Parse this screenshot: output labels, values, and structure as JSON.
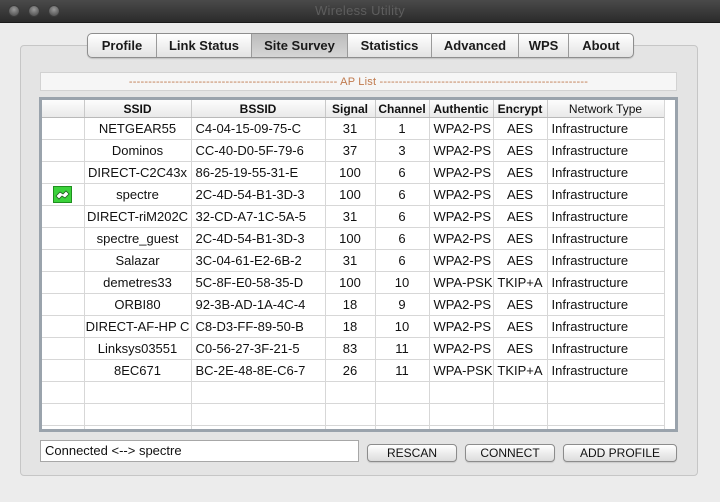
{
  "window": {
    "title": "Wireless Utility"
  },
  "tabs": [
    {
      "label": "Profile"
    },
    {
      "label": "Link Status"
    },
    {
      "label": "Site Survey"
    },
    {
      "label": "Statistics"
    },
    {
      "label": "Advanced"
    },
    {
      "label": "WPS"
    },
    {
      "label": "About"
    }
  ],
  "aplist": {
    "title": "------------------------------------------------------ AP List ------------------------------------------------------"
  },
  "table": {
    "columns": [
      "",
      "SSID",
      "BSSID",
      "Signal",
      "Channel",
      "Authentic",
      "Encrypt",
      "Network Type"
    ],
    "rows": [
      {
        "icon": "",
        "ssid": "NETGEAR55",
        "bssid": "C4-04-15-09-75-C",
        "signal": "31",
        "channel": "1",
        "auth": "WPA2-PS",
        "enc": "AES",
        "type": "Infrastructure"
      },
      {
        "icon": "",
        "ssid": "Dominos",
        "bssid": "CC-40-D0-5F-79-6",
        "signal": "37",
        "channel": "3",
        "auth": "WPA2-PS",
        "enc": "AES",
        "type": "Infrastructure"
      },
      {
        "icon": "",
        "ssid": "DIRECT-C2C43x",
        "bssid": "86-25-19-55-31-E",
        "signal": "100",
        "channel": "6",
        "auth": "WPA2-PS",
        "enc": "AES",
        "type": "Infrastructure"
      },
      {
        "icon": "connected-icon",
        "ssid": "spectre",
        "bssid": "2C-4D-54-B1-3D-3",
        "signal": "100",
        "channel": "6",
        "auth": "WPA2-PS",
        "enc": "AES",
        "type": "Infrastructure"
      },
      {
        "icon": "",
        "ssid": "DIRECT-riM202C",
        "bssid": "32-CD-A7-1C-5A-5",
        "signal": "31",
        "channel": "6",
        "auth": "WPA2-PS",
        "enc": "AES",
        "type": "Infrastructure"
      },
      {
        "icon": "",
        "ssid": "spectre_guest",
        "bssid": "2C-4D-54-B1-3D-3",
        "signal": "100",
        "channel": "6",
        "auth": "WPA2-PS",
        "enc": "AES",
        "type": "Infrastructure"
      },
      {
        "icon": "",
        "ssid": "Salazar",
        "bssid": "3C-04-61-E2-6B-2",
        "signal": "31",
        "channel": "6",
        "auth": "WPA2-PS",
        "enc": "AES",
        "type": "Infrastructure"
      },
      {
        "icon": "",
        "ssid": "demetres33",
        "bssid": "5C-8F-E0-58-35-D",
        "signal": "100",
        "channel": "10",
        "auth": "WPA-PSK",
        "enc": "TKIP+A",
        "type": "Infrastructure"
      },
      {
        "icon": "",
        "ssid": "ORBI80",
        "bssid": "92-3B-AD-1A-4C-4",
        "signal": "18",
        "channel": "9",
        "auth": "WPA2-PS",
        "enc": "AES",
        "type": "Infrastructure"
      },
      {
        "icon": "",
        "ssid": "DIRECT-AF-HP C",
        "bssid": "C8-D3-FF-89-50-B",
        "signal": "18",
        "channel": "10",
        "auth": "WPA2-PS",
        "enc": "AES",
        "type": "Infrastructure"
      },
      {
        "icon": "",
        "ssid": "Linksys03551",
        "bssid": "C0-56-27-3F-21-5",
        "signal": "83",
        "channel": "11",
        "auth": "WPA2-PS",
        "enc": "AES",
        "type": "Infrastructure"
      },
      {
        "icon": "",
        "ssid": "8EC671",
        "bssid": "BC-2E-48-8E-C6-7",
        "signal": "26",
        "channel": "11",
        "auth": "WPA-PSK",
        "enc": "TKIP+A",
        "type": "Infrastructure"
      }
    ]
  },
  "status": {
    "text": "Connected <--> spectre"
  },
  "buttons": {
    "rescan": "RESCAN",
    "connect": "CONNECT",
    "add_profile": "ADD PROFILE"
  },
  "colors": {
    "connected_icon": "#3bd23b",
    "aplist_text": "#c07a4e"
  }
}
